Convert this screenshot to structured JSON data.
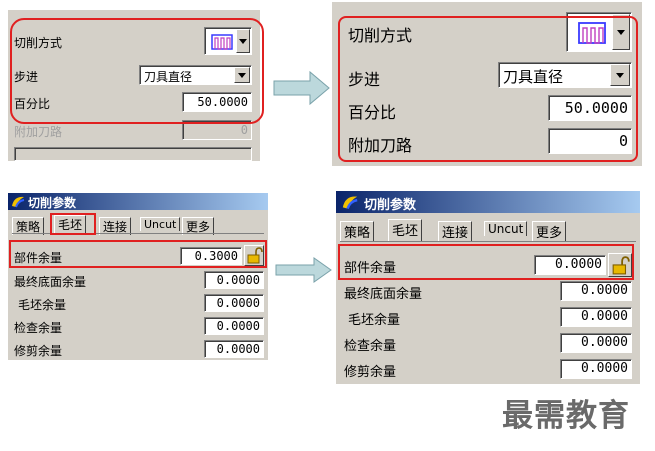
{
  "top_left": {
    "cut_method_label": "切削方式",
    "step_label": "步进",
    "step_value": "刀具直径",
    "percent_label": "百分比",
    "percent_value": "50.0000",
    "extra_path_label": "附加刀路",
    "extra_path_value": "0"
  },
  "top_right": {
    "cut_method_label": "切削方式",
    "step_label": "步进",
    "step_value": "刀具直径",
    "percent_label": "百分比",
    "percent_value": "50.0000",
    "extra_path_label": "附加刀路",
    "extra_path_value": "0"
  },
  "bottom_left": {
    "title": "切削参数",
    "tabs": [
      "策略",
      "毛坯",
      "连接",
      "Uncut",
      "更多"
    ],
    "rows": [
      {
        "label": "部件余量",
        "value": "0.3000"
      },
      {
        "label": "最终底面余量",
        "value": "0.0000"
      },
      {
        "label": "毛坯余量",
        "value": "0.0000"
      },
      {
        "label": "检查余量",
        "value": "0.0000"
      },
      {
        "label": "修剪余量",
        "value": "0.0000"
      }
    ]
  },
  "bottom_right": {
    "title": "切削参数",
    "tabs": [
      "策略",
      "毛坯",
      "连接",
      "Uncut",
      "更多"
    ],
    "rows": [
      {
        "label": "部件余量",
        "value": "0.0000"
      },
      {
        "label": "最终底面余量",
        "value": "0.0000"
      },
      {
        "label": "毛坯余量",
        "value": "0.0000"
      },
      {
        "label": "检查余量",
        "value": "0.0000"
      },
      {
        "label": "修剪余量",
        "value": "0.0000"
      }
    ]
  },
  "watermark": "最需教育",
  "colors": {
    "panel": "#d4d0c8",
    "highlight": "#e02020",
    "arrow": "#bcd8dc"
  }
}
